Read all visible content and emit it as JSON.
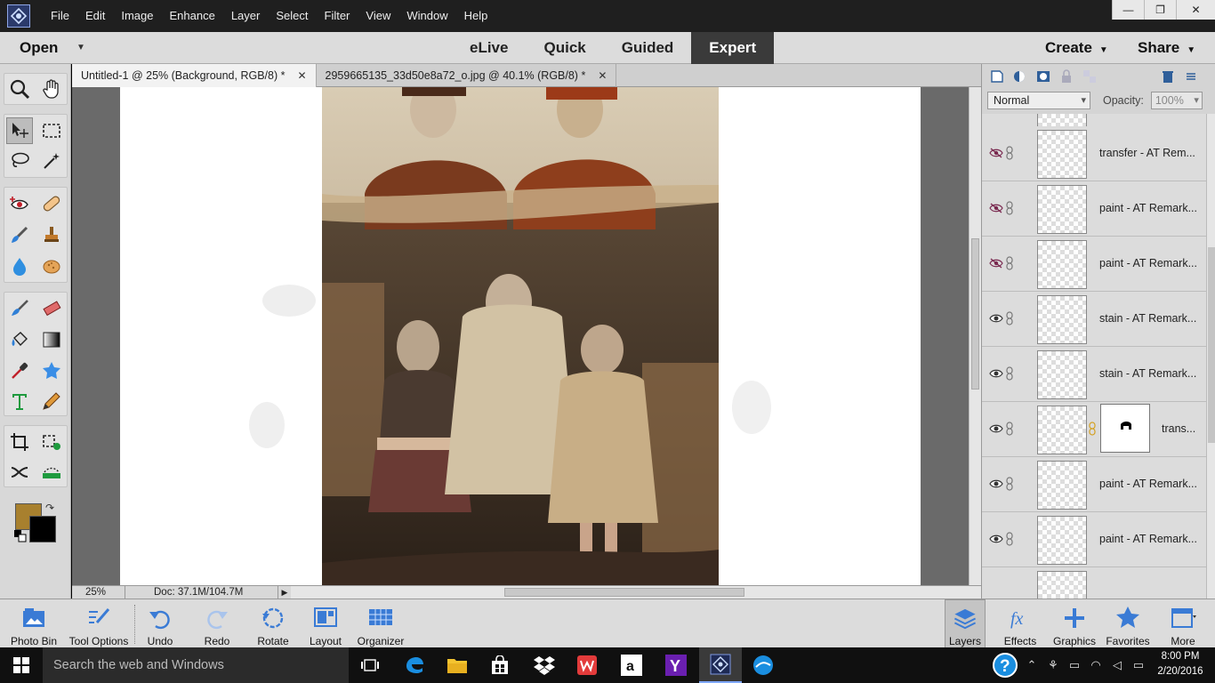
{
  "menubar": {
    "items": [
      "File",
      "Edit",
      "Image",
      "Enhance",
      "Layer",
      "Select",
      "Filter",
      "View",
      "Window",
      "Help"
    ]
  },
  "modebar": {
    "open_label": "Open",
    "tabs": [
      "eLive",
      "Quick",
      "Guided",
      "Expert"
    ],
    "active_tab": "Expert",
    "create_label": "Create",
    "share_label": "Share"
  },
  "colors": {
    "foreground": "#a8802e",
    "background": "#000000"
  },
  "document": {
    "tabs": [
      {
        "title": "Untitled-1 @ 25% (Background, RGB/8) *",
        "active": true
      },
      {
        "title": "2959665135_33d50e8a72_o.jpg @ 40.1% (RGB/8) *",
        "active": false
      }
    ],
    "zoom": "25%",
    "doc_size": "Doc: 37.1M/104.7M"
  },
  "layers_panel": {
    "blend_mode": "Normal",
    "opacity_label": "Opacity:",
    "opacity_value": "100%",
    "layers": [
      {
        "name": "transfer - AT Rem...",
        "visible": false
      },
      {
        "name": "paint - AT Remark...",
        "visible": false
      },
      {
        "name": "paint - AT Remark...",
        "visible": false
      },
      {
        "name": "stain - AT Remark...",
        "visible": true
      },
      {
        "name": "stain - AT Remark...",
        "visible": true
      },
      {
        "name": "trans...",
        "visible": true,
        "has_mask": true
      },
      {
        "name": "paint - AT Remark...",
        "visible": true
      },
      {
        "name": "paint - AT Remark...",
        "visible": true
      }
    ]
  },
  "bottombar": {
    "items": [
      "Photo Bin",
      "Tool Options",
      "Undo",
      "Redo",
      "Rotate",
      "Layout",
      "Organizer"
    ],
    "right_items": [
      "Layers",
      "Effects",
      "Graphics",
      "Favorites",
      "More"
    ]
  },
  "taskbar": {
    "search_placeholder": "Search the web and Windows",
    "time": "8:00 PM",
    "date": "2/20/2016"
  }
}
